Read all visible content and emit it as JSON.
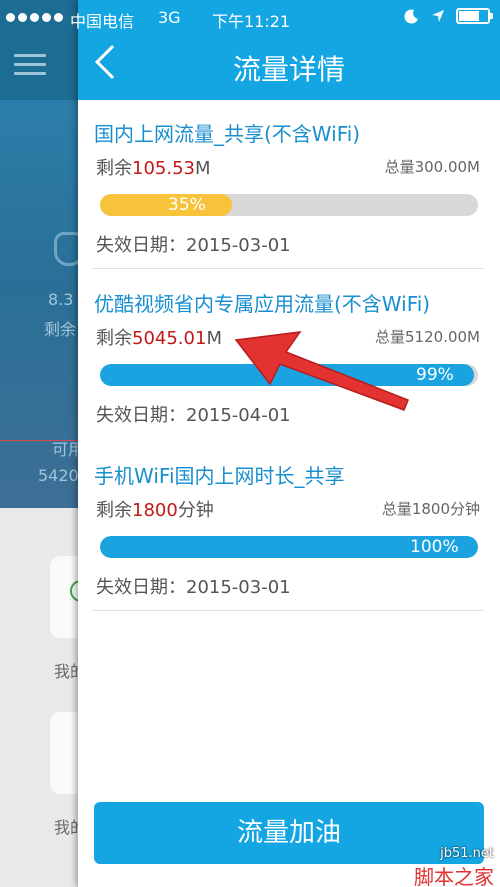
{
  "status_bar": {
    "carrier": "中国电信",
    "network": "3G",
    "time": "下午11:21"
  },
  "background_app": {
    "texts": [
      "8.3",
      "剩余",
      "可用",
      "5420",
      "我的",
      "我的"
    ]
  },
  "header": {
    "title": "流量详情",
    "back_icon": "chevron-left-icon"
  },
  "items": [
    {
      "title": "国内上网流量_共享(不含WiFi)",
      "remain_label": "剩余",
      "remain_value": "105.53",
      "remain_unit": "M",
      "total": "总量300.00M",
      "progress_label": "35%",
      "progress_fraction": 0.35,
      "bar_color": "#f7c33a",
      "expire": "失效日期：2015-03-01"
    },
    {
      "title": "优酷视频省内专属应用流量(不含WiFi)",
      "remain_label": "剩余",
      "remain_value": "5045.01",
      "remain_unit": "M",
      "total": "总量5120.00M",
      "progress_label": "99%",
      "progress_fraction": 0.99,
      "bar_color": "#1aa3e0",
      "expire": "失效日期：2015-04-01"
    },
    {
      "title": "手机WiFi国内上网时长_共享",
      "remain_label": "剩余",
      "remain_value": "1800",
      "remain_unit": "分钟",
      "total": "总量1800分钟",
      "progress_label": "100%",
      "progress_fraction": 1.0,
      "bar_color": "#1aa3e0",
      "expire": "失效日期：2015-03-01"
    }
  ],
  "footer": {
    "refuel_button": "流量加油"
  },
  "watermark": {
    "url": "jb51.net",
    "name": "脚本之家"
  },
  "colors": {
    "accent": "#14a5e3",
    "remain_value": "#c41818",
    "annotation_arrow": "#e23232"
  }
}
